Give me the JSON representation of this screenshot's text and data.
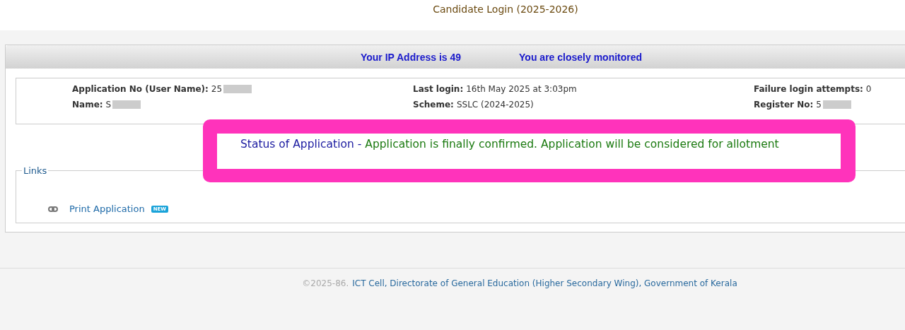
{
  "title": "Candidate Login (2025-2026)",
  "ip_bar": {
    "ip_text": "Your IP Address is 49",
    "warning": "You are closely monitored"
  },
  "info": [
    {
      "label": "Application No (User Name):",
      "value": "25",
      "redacted": true
    },
    {
      "label": "Last login:",
      "value": "16th May 2025 at 3:03pm",
      "redacted": false
    },
    {
      "label": "Failure login attempts:",
      "value": "0",
      "redacted": false
    },
    {
      "label": "Name:",
      "value": "S",
      "redacted": true
    },
    {
      "label": "Scheme:",
      "value": "SSLC (2024-2025)",
      "redacted": false
    },
    {
      "label": "Register No:",
      "value": "5",
      "redacted": true
    }
  ],
  "status": {
    "label": "Status of Application -",
    "value": "Application is finally confirmed. Application will be considered for allotment"
  },
  "links": {
    "legend": "Links",
    "items": [
      {
        "label": "Print Application",
        "badge": "NEW"
      }
    ]
  },
  "footer": {
    "copyright": "©2025-86.",
    "credit": "ICT Cell, Directorate of General Education (Higher Secondary Wing), Government of Kerala"
  }
}
